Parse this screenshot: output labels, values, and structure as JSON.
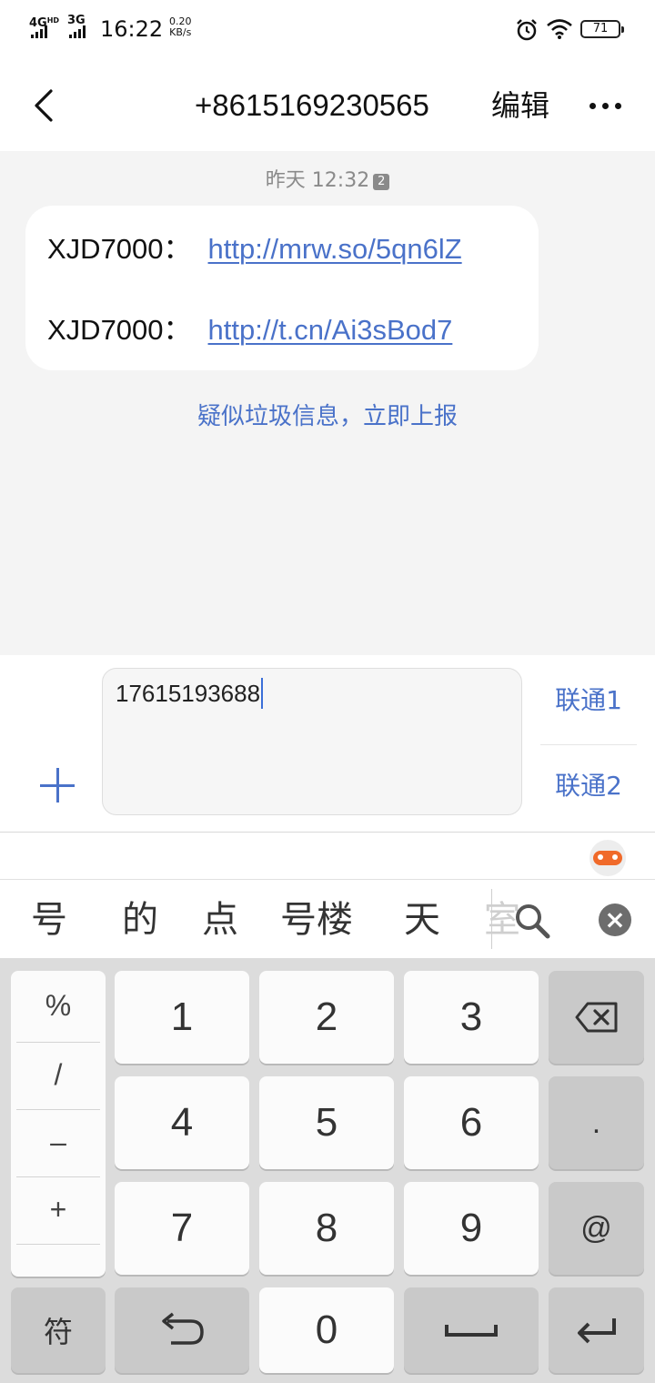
{
  "status_bar": {
    "net1": "4G",
    "net1_sup": "HD",
    "net2": "3G",
    "time": "16:22",
    "speed_value": "0.20",
    "speed_unit": "KB/s",
    "battery": "71",
    "icons": [
      "alarm-icon",
      "wifi-icon",
      "battery-icon"
    ]
  },
  "header": {
    "contact": "+8615169230565",
    "edit_label": "编辑",
    "back_icon": "chevron-left-icon",
    "more_icon": "more-dots-icon"
  },
  "conversation": {
    "timestamp": "昨天 12:32",
    "sim_badge": "2",
    "messages": [
      {
        "sender": "XJD7000：",
        "link": "http://mrw.so/5qn6lZ"
      },
      {
        "sender": "XJD7000：",
        "link": "http://t.cn/Ai3sBod7"
      }
    ],
    "spam_notice": "疑似垃圾信息，立即上报"
  },
  "compose": {
    "input_value": "17615193688",
    "sim1_label": "联通1",
    "sim2_label": "联通2",
    "add_icon": "plus-icon"
  },
  "keyboard": {
    "candidates": [
      "号",
      "的",
      "点",
      "号楼",
      "天",
      "室"
    ],
    "search_icon": "search-icon",
    "close_label": "×",
    "symbols": [
      "%",
      "/",
      "–",
      "+"
    ],
    "digits": [
      "1",
      "2",
      "3",
      "4",
      "5",
      "6",
      "7",
      "8",
      "9",
      "0"
    ],
    "dot_label": ".",
    "at_label": "@",
    "symbol_switch_label": "符"
  },
  "colors": {
    "accent": "#4a72c9",
    "background": "#f4f4f4",
    "bubble": "#ffffff",
    "key_light": "#fbfbfb",
    "key_dark": "#c9c9c9",
    "mascot": "#f06a2a"
  }
}
